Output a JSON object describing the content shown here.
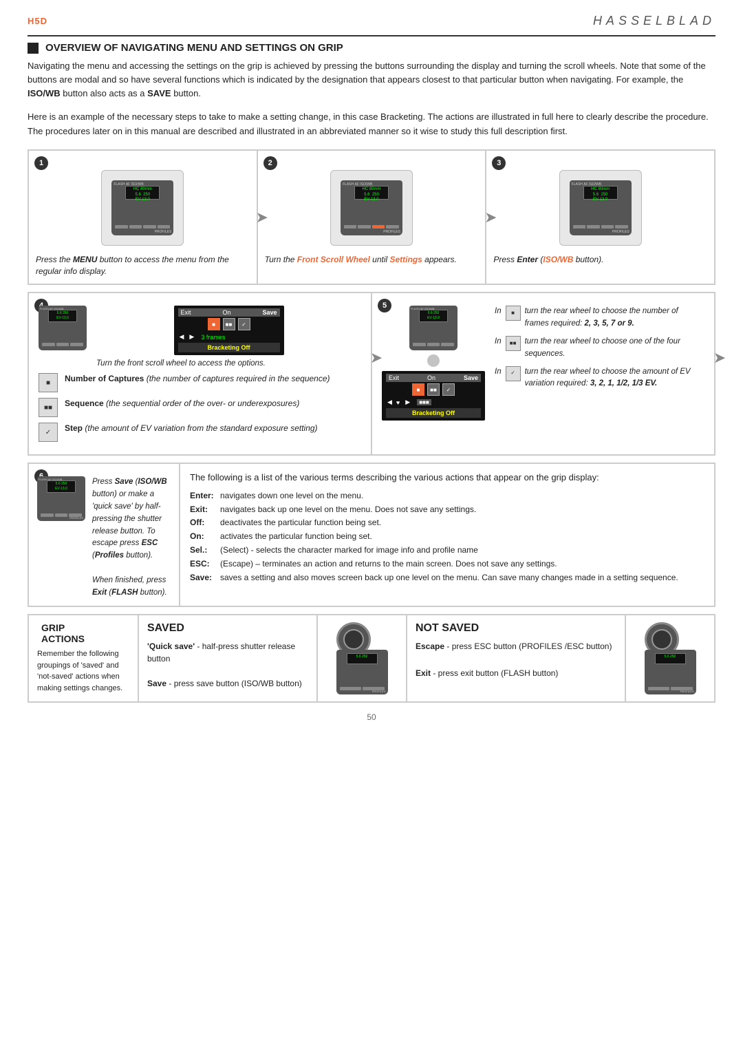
{
  "header": {
    "left": "H5D",
    "right": "HASSELBLAD"
  },
  "section_title": "OVERVIEW OF NAVIGATING MENU AND SETTINGS ON GRIP",
  "intro": "Navigating the menu and accessing the settings on the grip is achieved by pressing the buttons surrounding the display and turning the scroll wheels. Note that some of the buttons are modal and so have several functions which is indicated by the designation that appears closest to that particular button when navigating. For example, the ISO/WB button also acts as a SAVE button.",
  "intro_bold1": "ISO/WB",
  "intro_bold2": "SAVE",
  "example_text": "Here is an example of the necessary steps to take to make a setting change, in this case Bracketing. The actions are illustrated in full here to clearly describe the procedure. The procedures later on in this manual are described and illustrated in an abbreviated manner so it wise to study this full description first.",
  "steps": [
    {
      "num": "1",
      "caption": "Press the MENU button to access the menu from the regular info display.",
      "caption_italic_prefix": "Press the ",
      "caption_bold": "MENU",
      "caption_italic_suffix": " button to access the menu from the regular info display.",
      "display_lines": [
        "HC 80mm",
        "FLASH  AF  ISO/WB",
        "5.6  250",
        "EV-13.0  ISO 1600",
        "PROFILES"
      ]
    },
    {
      "num": "2",
      "caption_prefix": "Turn the ",
      "caption_bold": "Front Scroll Wheel",
      "caption_mid": " until ",
      "caption_bold2": "Settings",
      "caption_suffix": " appears.",
      "display_lines": [
        "HC 80mm",
        "FLASH  AF  ISO/WB",
        "5.6  250",
        "EV-13.0  ISO 1600",
        "PROFILES"
      ]
    },
    {
      "num": "3",
      "caption_prefix": "Press ",
      "caption_bold": "Enter",
      "caption_mid": " (",
      "caption_bold2": "ISO/WB",
      "caption_suffix": " button).",
      "display_lines": [
        "HC 80mm",
        "FLASH  AF  ISO/WB",
        "5.6  250",
        "EV-13.0  ISO 1600",
        "PROFILES"
      ]
    },
    {
      "num": "4",
      "caption": "Turn the front scroll wheel to access the options.",
      "menu_top": [
        "Exit",
        "On",
        "Save"
      ],
      "menu_icons": [
        "frame",
        "seq",
        "step"
      ],
      "menu_frames": "3 frames",
      "menu_bracketing": "Bracketing Off",
      "icon_items": [
        {
          "label": "Number of Captures",
          "desc": "(the number of captures required in the sequence)"
        },
        {
          "label": "Sequence",
          "desc": "(the sequential order of the over- or underexposures)"
        },
        {
          "label": "Step",
          "desc": "(the amount of EV variation from the standard exposure setting)"
        }
      ]
    },
    {
      "num": "5",
      "menu_top": [
        "Exit",
        "On",
        "Save"
      ],
      "menu_bracketing": "Bracketing Off",
      "texts": [
        {
          "icon_type": "frame",
          "text_prefix": "In ",
          "text_italic": " turn the rear wheel to choose the number of frames required: ",
          "text_bold": "2, 3, 5, 7 or 9."
        },
        {
          "icon_type": "seq",
          "text_prefix": "In ",
          "text_italic": " turn the rear wheel to choose one of the four sequences."
        },
        {
          "icon_type": "step",
          "text_prefix": "In ",
          "text_italic": " turn the rear wheel to choose the amount of EV variation required: ",
          "text_bold": "3, 2, 1, 1/2, 1/3 EV."
        }
      ]
    }
  ],
  "step6": {
    "num": "6",
    "caption_lines": [
      "Press Save (ISO/WB button) or make a 'quick save' by half-pressing the shutter release button. To escape press ESC (Profiles button).",
      "When finished, press Exit (FLASH button)."
    ],
    "bold_words": [
      "Save",
      "ESC",
      "Profiles",
      "Exit",
      "FLASH",
      "ISO/WB"
    ]
  },
  "terms": {
    "intro": "The following is a list of the various terms describing the various actions that appear on the grip display:",
    "items": [
      {
        "key": "Enter:",
        "desc": "navigates down one level on the menu."
      },
      {
        "key": "Exit:",
        "desc": "navigates back up one level on the menu. Does not save any settings."
      },
      {
        "key": "Off:",
        "desc": "deactivates the particular function being set."
      },
      {
        "key": "On:",
        "desc": "activates the particular function being set."
      },
      {
        "key": "Sel.:",
        "desc": "(Select) - selects the character marked for image info and profile name"
      },
      {
        "key": "ESC:",
        "desc": "(Escape) – terminates an action and returns to the main screen. Does not save any settings."
      },
      {
        "key": "Save:",
        "desc": "saves a setting and also moves screen back up one level on the menu. Can save many changes made in a setting sequence."
      }
    ]
  },
  "grip_actions": {
    "title": "GRIP ACTIONS",
    "body": "Remember the following groupings of 'saved' and 'not-saved' actions when making settings changes.",
    "saved_title": "SAVED",
    "saved_items": [
      {
        "label": "'Quick save'",
        "desc": "- half-press shutter release button"
      },
      {
        "label": "Save",
        "desc": "- press save button (ISO/WB button)"
      }
    ],
    "not_saved_title": "NOT SAVED",
    "not_saved_items": [
      {
        "label": "Escape",
        "desc": "- press ESC button (PROFILES /ESC button)"
      },
      {
        "label": "Exit",
        "desc": "- press exit button (FLASH button)"
      }
    ]
  },
  "page_number": "50"
}
